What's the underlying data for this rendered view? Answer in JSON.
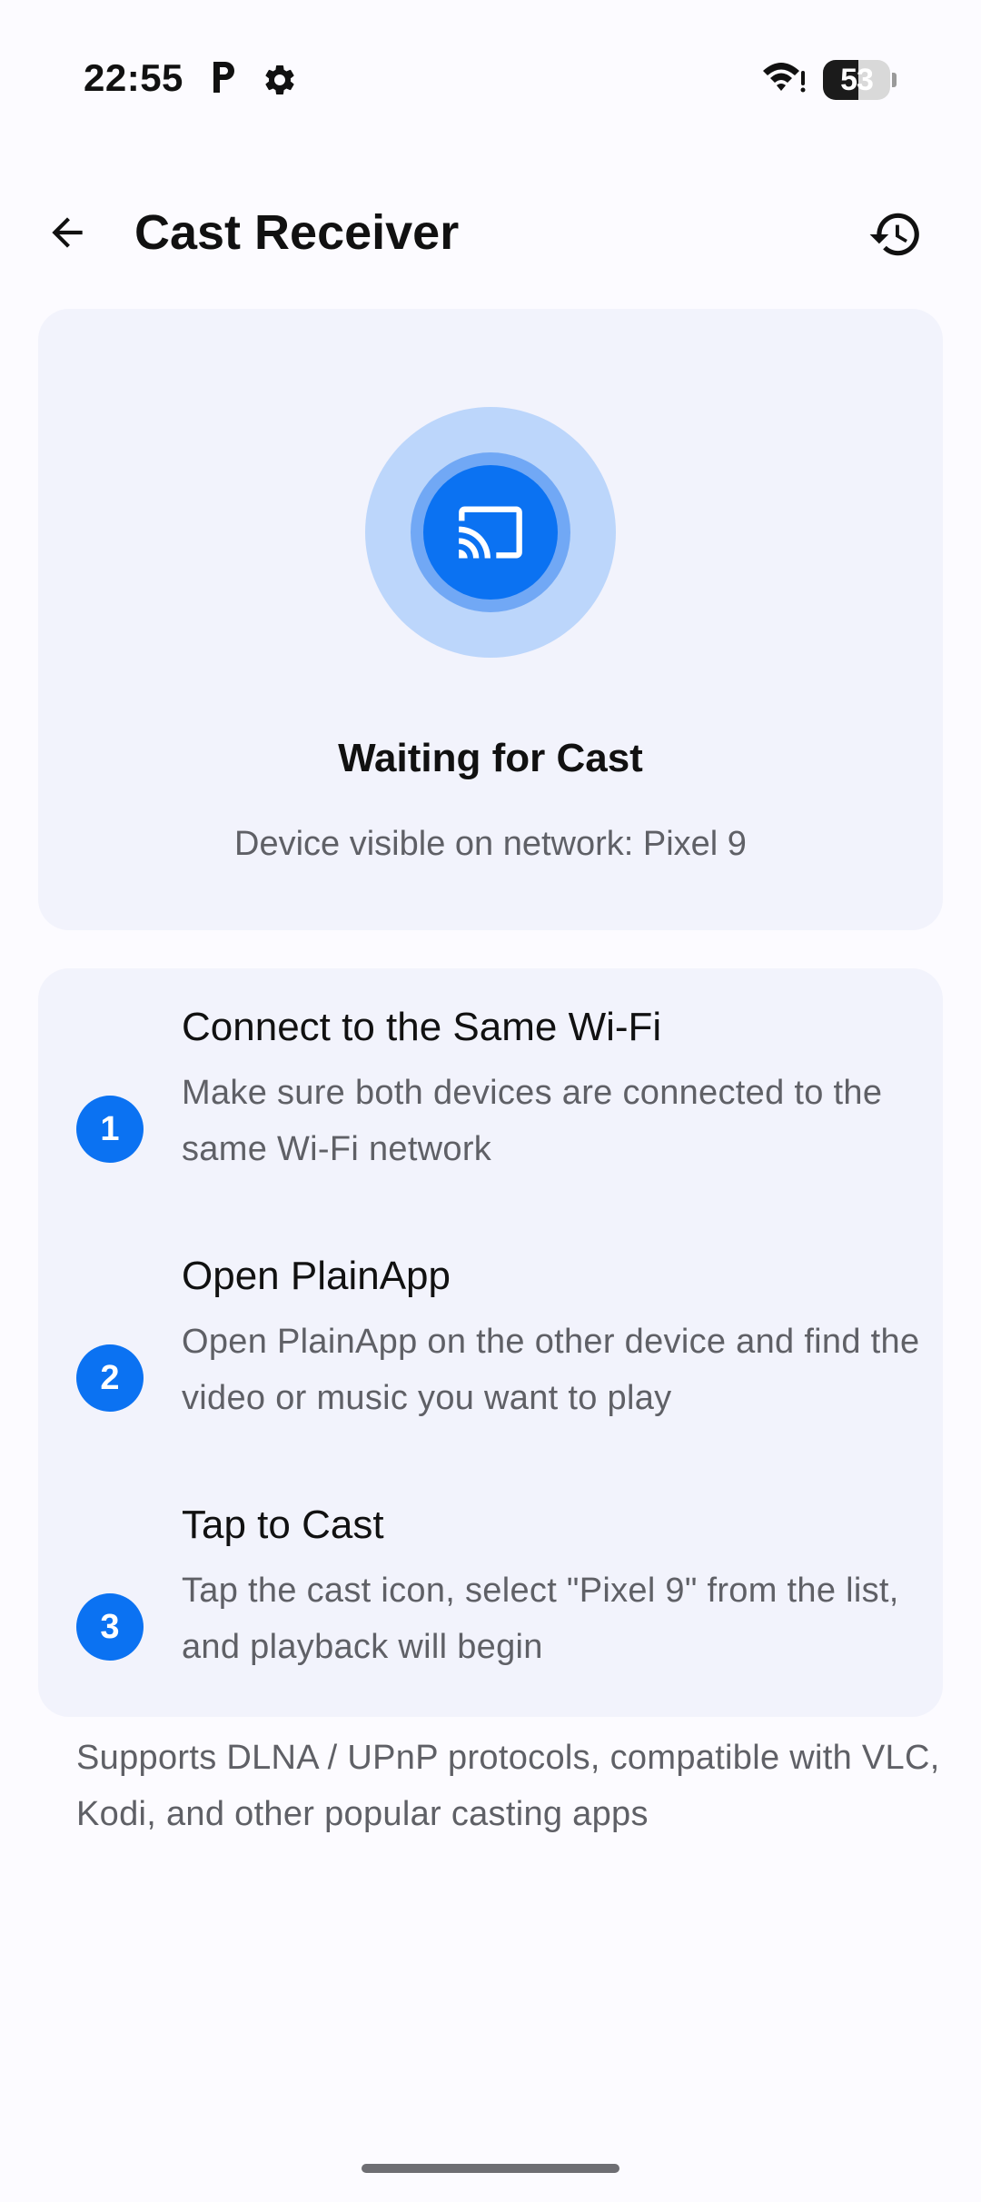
{
  "status_bar": {
    "time": "22:55",
    "battery_percent": 53,
    "battery_label": "53"
  },
  "app_bar": {
    "title": "Cast Receiver"
  },
  "status_card": {
    "heading": "Waiting for Cast",
    "subtitle": "Device visible on network: Pixel 9"
  },
  "steps": [
    {
      "number": "1",
      "title": "Connect to the Same Wi-Fi",
      "description": "Make sure both devices are connected to the same Wi-Fi network"
    },
    {
      "number": "2",
      "title": "Open PlainApp",
      "description": "Open PlainApp on the other device and find the video or music you want to play"
    },
    {
      "number": "3",
      "title": "Tap to Cast",
      "description": "Tap the cast icon, select \"Pixel 9\" from the list, and playback will begin"
    }
  ],
  "footer_note": "Supports DLNA / UPnP protocols, compatible with VLC, Kodi, and other popular casting apps",
  "colors": {
    "accent": "#0b72f2",
    "card_background": "#f2f3fc",
    "page_background": "#fcfbff"
  },
  "icons": {
    "back": "arrow-left-icon",
    "history": "history-icon",
    "cast": "cast-icon",
    "status_p": "parking-icon",
    "status_settings": "gear-icon",
    "status_wifi": "wifi-icon"
  }
}
